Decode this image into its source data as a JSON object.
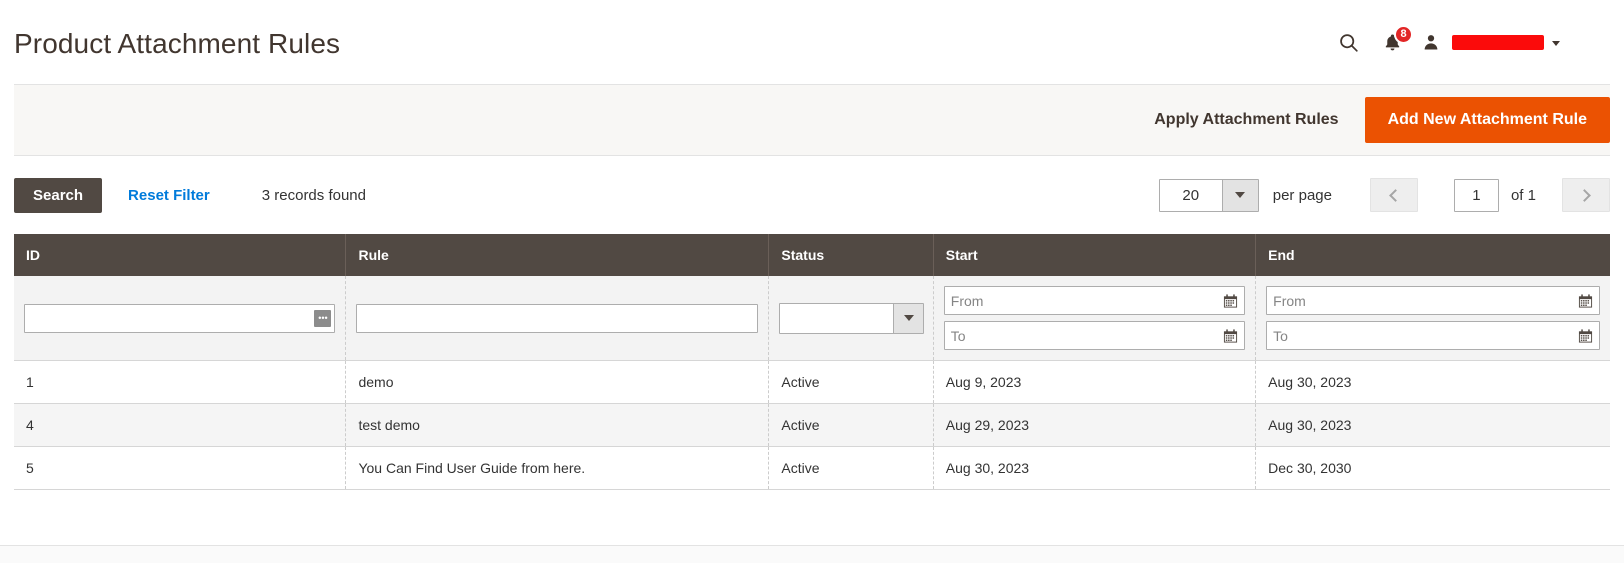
{
  "header": {
    "title": "Product Attachment Rules",
    "search_icon": "search-icon",
    "notifications_icon": "bell-icon",
    "notifications_count": "8",
    "user_icon": "user-icon",
    "account_name_redacted": "",
    "caret_icon": "chevron-down-icon"
  },
  "page_actions": {
    "apply_label": "Apply Attachment Rules",
    "add_new_label": "Add New Attachment Rule",
    "primary_color": "#eb5202"
  },
  "toolbar": {
    "search_label": "Search",
    "reset_filter_label": "Reset Filter",
    "records_found": "3 records found",
    "per_page_value": "20",
    "per_page_label": "per page",
    "prev_icon": "chevron-left-icon",
    "next_icon": "chevron-right-icon",
    "current_page": "1",
    "of_label": "of 1",
    "link_color": "#007bdb"
  },
  "grid": {
    "columns": [
      {
        "label": "ID"
      },
      {
        "label": "Rule"
      },
      {
        "label": "Status"
      },
      {
        "label": "Start"
      },
      {
        "label": "End"
      }
    ],
    "filters": {
      "id_value": "",
      "id_chooser_icon": "chooser-icon",
      "rule_value": "",
      "status_value": "",
      "start_from_placeholder": "From",
      "start_to_placeholder": "To",
      "end_from_placeholder": "From",
      "end_to_placeholder": "To",
      "calendar_icon": "calendar-icon"
    },
    "rows": [
      {
        "id": "1",
        "rule": "demo",
        "status": "Active",
        "start": "Aug 9, 2023",
        "end": "Aug 30, 2023"
      },
      {
        "id": "4",
        "rule": "test demo",
        "status": "Active",
        "start": "Aug 29, 2023",
        "end": "Aug 30, 2023"
      },
      {
        "id": "5",
        "rule": "You Can Find User Guide from here.",
        "status": "Active",
        "start": "Aug 30, 2023",
        "end": "Dec 30, 2030"
      }
    ]
  }
}
